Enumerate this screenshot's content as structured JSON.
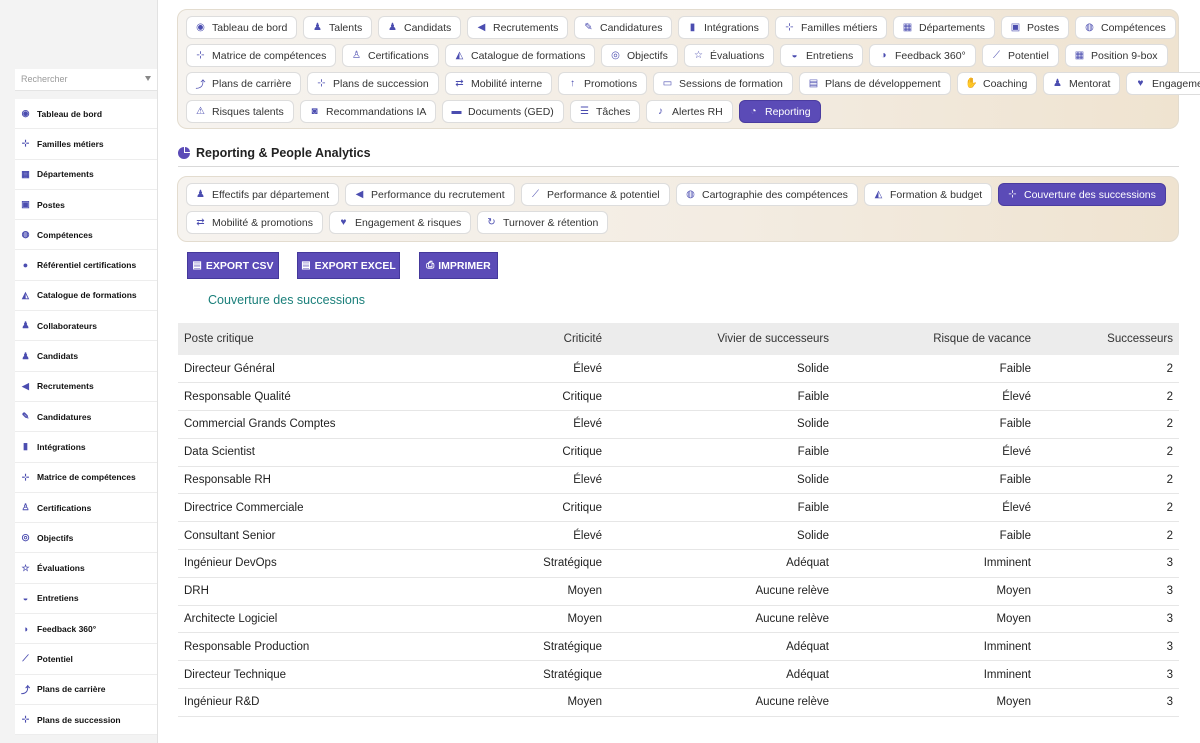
{
  "sidebar": {
    "search_placeholder": "Rechercher",
    "items": [
      {
        "label": "Tableau de bord",
        "icon": "gauge-icon",
        "glyph": "◉"
      },
      {
        "label": "Familles métiers",
        "icon": "sitemap-icon",
        "glyph": "⊹"
      },
      {
        "label": "Départements",
        "icon": "building-icon",
        "glyph": "▦"
      },
      {
        "label": "Postes",
        "icon": "id-badge-icon",
        "glyph": "▣"
      },
      {
        "label": "Compétences",
        "icon": "brain-icon",
        "glyph": "◍"
      },
      {
        "label": "Référentiel certifications",
        "icon": "certificate-icon",
        "glyph": "●"
      },
      {
        "label": "Catalogue de formations",
        "icon": "graduation-cap-icon",
        "glyph": "◭"
      },
      {
        "label": "Collaborateurs",
        "icon": "user-icon",
        "glyph": "♟"
      },
      {
        "label": "Candidats",
        "icon": "user-plus-icon",
        "glyph": "♟"
      },
      {
        "label": "Recrutements",
        "icon": "bullhorn-icon",
        "glyph": "◀"
      },
      {
        "label": "Candidatures",
        "icon": "file-signature-icon",
        "glyph": "✎"
      },
      {
        "label": "Intégrations",
        "icon": "door-open-icon",
        "glyph": "▮"
      },
      {
        "label": "Matrice de compétences",
        "icon": "sitemap-icon",
        "glyph": "⊹"
      },
      {
        "label": "Certifications",
        "icon": "award-icon",
        "glyph": "♙"
      },
      {
        "label": "Objectifs",
        "icon": "bullseye-icon",
        "glyph": "◎"
      },
      {
        "label": "Évaluations",
        "icon": "star-half-icon",
        "glyph": "☆"
      },
      {
        "label": "Entretiens",
        "icon": "comments-icon",
        "glyph": "◒"
      },
      {
        "label": "Feedback 360°",
        "icon": "comment-dots-icon",
        "glyph": "◑"
      },
      {
        "label": "Potentiel",
        "icon": "chart-line-icon",
        "glyph": "⟋"
      },
      {
        "label": "Plans de carrière",
        "icon": "route-icon",
        "glyph": "⤴"
      },
      {
        "label": "Plans de succession",
        "icon": "sitemap-icon",
        "glyph": "⊹"
      }
    ]
  },
  "nav": {
    "rows": [
      [
        {
          "label": "Tableau de bord",
          "icon": "gauge-icon",
          "glyph": "◉"
        },
        {
          "label": "Talents",
          "icon": "user-tie-icon",
          "glyph": "♟"
        },
        {
          "label": "Candidats",
          "icon": "user-plus-icon",
          "glyph": "♟"
        },
        {
          "label": "Recrutements",
          "icon": "bullhorn-icon",
          "glyph": "◀"
        },
        {
          "label": "Candidatures",
          "icon": "file-signature-icon",
          "glyph": "✎"
        },
        {
          "label": "Intégrations",
          "icon": "door-open-icon",
          "glyph": "▮"
        },
        {
          "label": "Familles métiers",
          "icon": "sitemap-icon",
          "glyph": "⊹"
        },
        {
          "label": "Départements",
          "icon": "building-icon",
          "glyph": "▦"
        },
        {
          "label": "Postes",
          "icon": "id-badge-icon",
          "glyph": "▣"
        },
        {
          "label": "Compétences",
          "icon": "brain-icon",
          "glyph": "◍"
        }
      ],
      [
        {
          "label": "Matrice de compétences",
          "icon": "sitemap-icon",
          "glyph": "⊹"
        },
        {
          "label": "Certifications",
          "icon": "award-icon",
          "glyph": "♙"
        },
        {
          "label": "Catalogue de formations",
          "icon": "graduation-cap-icon",
          "glyph": "◭"
        },
        {
          "label": "Objectifs",
          "icon": "bullseye-icon",
          "glyph": "◎"
        },
        {
          "label": "Évaluations",
          "icon": "star-half-icon",
          "glyph": "☆"
        },
        {
          "label": "Entretiens",
          "icon": "comments-icon",
          "glyph": "◒"
        },
        {
          "label": "Feedback 360°",
          "icon": "comment-dots-icon",
          "glyph": "◑"
        },
        {
          "label": "Potentiel",
          "icon": "chart-line-icon",
          "glyph": "⟋"
        },
        {
          "label": "Position 9-box",
          "icon": "grid-icon",
          "glyph": "▦"
        }
      ],
      [
        {
          "label": "Plans de carrière",
          "icon": "route-icon",
          "glyph": "⤴"
        },
        {
          "label": "Plans de succession",
          "icon": "sitemap-icon",
          "glyph": "⊹"
        },
        {
          "label": "Mobilité interne",
          "icon": "exchange-icon",
          "glyph": "⇄"
        },
        {
          "label": "Promotions",
          "icon": "arrow-up-icon",
          "glyph": "↑"
        },
        {
          "label": "Sessions de formation",
          "icon": "chalkboard-icon",
          "glyph": "▭"
        },
        {
          "label": "Plans de développement",
          "icon": "clipboard-icon",
          "glyph": "▤"
        },
        {
          "label": "Coaching",
          "icon": "handshake-icon",
          "glyph": "✋"
        },
        {
          "label": "Mentorat",
          "icon": "user-graduate-icon",
          "glyph": "♟"
        },
        {
          "label": "Engagement",
          "icon": "heart-icon",
          "glyph": "♥"
        }
      ],
      [
        {
          "label": "Risques talents",
          "icon": "warning-icon",
          "glyph": "⚠"
        },
        {
          "label": "Recommandations IA",
          "icon": "robot-icon",
          "glyph": "◙"
        },
        {
          "label": "Documents (GED)",
          "icon": "folder-icon",
          "glyph": "▬"
        },
        {
          "label": "Tâches",
          "icon": "tasks-icon",
          "glyph": "☰"
        },
        {
          "label": "Alertes RH",
          "icon": "bell-icon",
          "glyph": "♪"
        },
        {
          "label": "Reporting",
          "icon": "chart-pie-icon",
          "glyph": "◔",
          "active": true
        }
      ]
    ]
  },
  "section": {
    "title": "Reporting & People Analytics",
    "icon": "chart-pie-icon"
  },
  "report_tabs": {
    "rows": [
      [
        {
          "label": "Effectifs par département",
          "icon": "users-icon",
          "glyph": "♟"
        },
        {
          "label": "Performance du recrutement",
          "icon": "bullhorn-icon",
          "glyph": "◀"
        },
        {
          "label": "Performance & potentiel",
          "icon": "chart-line-icon",
          "glyph": "⟋"
        },
        {
          "label": "Cartographie des compétences",
          "icon": "brain-icon",
          "glyph": "◍"
        },
        {
          "label": "Formation & budget",
          "icon": "graduation-cap-icon",
          "glyph": "◭"
        },
        {
          "label": "Couverture des successions",
          "icon": "sitemap-icon",
          "glyph": "⊹",
          "active": true
        }
      ],
      [
        {
          "label": "Mobilité & promotions",
          "icon": "exchange-icon",
          "glyph": "⇄"
        },
        {
          "label": "Engagement & risques",
          "icon": "heart-icon",
          "glyph": "♥"
        },
        {
          "label": "Turnover & rétention",
          "icon": "sync-icon",
          "glyph": "↻"
        }
      ]
    ]
  },
  "exports": {
    "csv": "EXPORT CSV",
    "excel": "EXPORT EXCEL",
    "print": "IMPRIMER"
  },
  "report": {
    "title": "Couverture des successions",
    "columns": [
      "Poste critique",
      "Criticité",
      "Vivier de successeurs",
      "Risque de vacance",
      "Successeurs"
    ],
    "rows": [
      [
        "Directeur Général",
        "Élevé",
        "Solide",
        "Faible",
        "2"
      ],
      [
        "Responsable Qualité",
        "Critique",
        "Faible",
        "Élevé",
        "2"
      ],
      [
        "Commercial Grands Comptes",
        "Élevé",
        "Solide",
        "Faible",
        "2"
      ],
      [
        "Data Scientist",
        "Critique",
        "Faible",
        "Élevé",
        "2"
      ],
      [
        "Responsable RH",
        "Élevé",
        "Solide",
        "Faible",
        "2"
      ],
      [
        "Directrice Commerciale",
        "Critique",
        "Faible",
        "Élevé",
        "2"
      ],
      [
        "Consultant Senior",
        "Élevé",
        "Solide",
        "Faible",
        "2"
      ],
      [
        "Ingénieur DevOps",
        "Stratégique",
        "Adéquat",
        "Imminent",
        "3"
      ],
      [
        "DRH",
        "Moyen",
        "Aucune relève",
        "Moyen",
        "3"
      ],
      [
        "Architecte Logiciel",
        "Moyen",
        "Aucune relève",
        "Moyen",
        "3"
      ],
      [
        "Responsable Production",
        "Stratégique",
        "Adéquat",
        "Imminent",
        "3"
      ],
      [
        "Directeur Technique",
        "Stratégique",
        "Adéquat",
        "Imminent",
        "3"
      ],
      [
        "Ingénieur R&D",
        "Moyen",
        "Aucune relève",
        "Moyen",
        "3"
      ]
    ]
  },
  "colors": {
    "accent": "#5b4bb7",
    "report_title": "#1a7f7a"
  }
}
